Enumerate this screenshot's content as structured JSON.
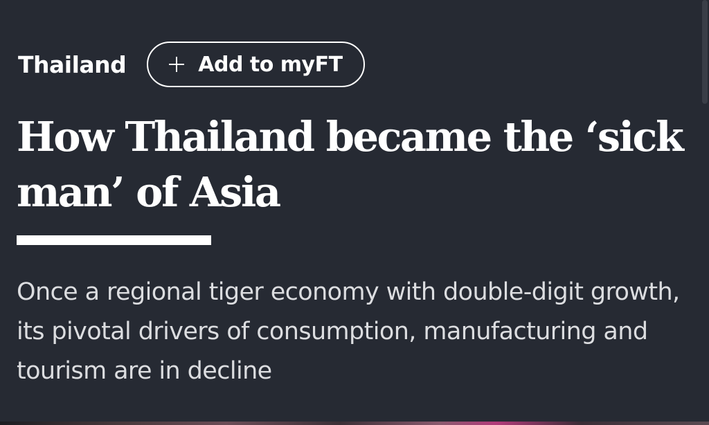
{
  "topic": {
    "label": "Thailand"
  },
  "follow_button": {
    "icon": "plus-icon",
    "label": "Add to myFT"
  },
  "headline": "How Thailand became the ‘sick man’ of Asia",
  "standfirst": "Once a regional tiger economy with double-digit growth, its pivotal drivers of consumption, manufacturing and tourism are in decline",
  "colors": {
    "background": "#262a33",
    "text": "#ffffff",
    "standfirst_text": "#dcdde0"
  }
}
